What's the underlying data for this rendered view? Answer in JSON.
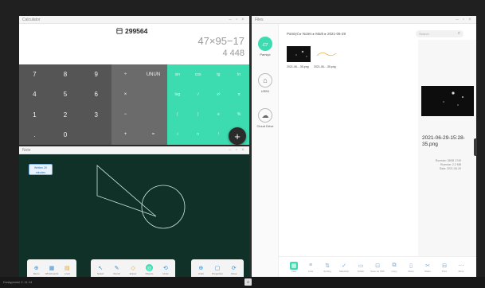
{
  "calculator": {
    "title": "Calculator",
    "memory_value": "299564",
    "expression": "47×95−17",
    "result": "4 448",
    "num_keys": [
      "7",
      "8",
      "9",
      "4",
      "5",
      "6",
      "1",
      "2",
      "3",
      ".",
      "0",
      ""
    ],
    "op_keys": [
      "÷",
      "UNUN",
      "×",
      "",
      "−",
      "",
      "+",
      "="
    ],
    "sci_keys": [
      "sin",
      "cos",
      "tg",
      "ln",
      "log",
      "√",
      "x²",
      "π",
      "(",
      ")",
      "e",
      "%",
      "√",
      "n",
      "!",
      "≡"
    ],
    "fab_label": "+"
  },
  "note": {
    "title": "Note",
    "badge_text": "Written 20 minutes",
    "toolbar_left": [
      {
        "icon": "⊕",
        "label": "Menu"
      },
      {
        "icon": "▦",
        "label": "Whiteboards"
      },
      {
        "icon": "▤",
        "label": "Load"
      }
    ],
    "toolbar_mid": [
      {
        "icon": "↖",
        "label": "Select"
      },
      {
        "icon": "✎",
        "label": "Pencil"
      },
      {
        "icon": "◇",
        "label": "Eraser"
      },
      {
        "icon": "◎",
        "label": "Objects"
      },
      {
        "icon": "⟲",
        "label": "Undo"
      }
    ],
    "toolbar_right": [
      {
        "icon": "⊕",
        "label": "Undo"
      },
      {
        "icon": "▢",
        "label": "Properties"
      },
      {
        "icon": "⟳",
        "label": "Close"
      }
    ]
  },
  "files": {
    "title": "Files",
    "breadcrumb": "Pamięć ▸ Notes ▸ Mark ▸ 2021-06-29",
    "search_placeholder": "Search",
    "sidebar": [
      {
        "icon": "▱",
        "label": "Pamięć"
      },
      {
        "icon": "⌂",
        "label": "USB1"
      },
      {
        "icon": "☁",
        "label": "Cloud Drive"
      }
    ],
    "items": [
      {
        "name": "2021-06-...35.png"
      },
      {
        "name": "2021-06-...35.png"
      }
    ],
    "preview": {
      "name": "2021-06-29-15:28-35.png",
      "meta": [
        "Rozmiar: 38KB 1749",
        "Rozmiar: 2,2 MB",
        "Data: 2021-06-29"
      ]
    },
    "bottom_bar": [
      {
        "icon": "▦",
        "label": "View"
      },
      {
        "icon": "≡",
        "label": "Lists"
      },
      {
        "icon": "⇅",
        "label": "Sorting"
      },
      {
        "icon": "✓",
        "label": "Selection"
      },
      {
        "icon": "▭",
        "label": "Folder"
      },
      {
        "icon": "⊡",
        "label": "Save as PDF"
      },
      {
        "icon": "⧉",
        "label": "Copy"
      },
      {
        "icon": "▯",
        "label": "Move"
      },
      {
        "icon": "✂",
        "label": "Share"
      },
      {
        "icon": "⊟",
        "label": "Print"
      },
      {
        "icon": "⋯",
        "label": "More"
      }
    ]
  },
  "taskbar": {
    "left_text": "Dostępność 2: 11:14",
    "center_icon": "home-icon"
  },
  "colors": {
    "accent": "#3ddbb0",
    "note_bg": "#0f3127"
  }
}
